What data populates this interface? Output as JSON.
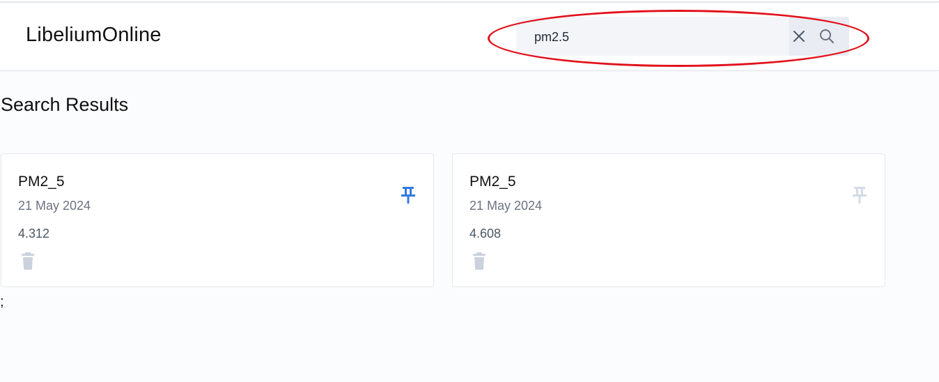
{
  "app": {
    "title": "LibeliumOnline"
  },
  "search": {
    "value": "pm2.5",
    "clear_icon": "close-icon",
    "submit_icon": "search-icon"
  },
  "results": {
    "heading": "Search Results",
    "cards": [
      {
        "title": "PM2_5",
        "date": "21 May 2024",
        "value": "4.312",
        "pinned": true
      },
      {
        "title": "PM2_5",
        "date": "21 May 2024",
        "value": "4.608",
        "pinned": false
      }
    ],
    "trailing_text": ";"
  },
  "colors": {
    "pin_active": "#2f7be0",
    "pin_inactive": "#d4dbe6",
    "delete_icon": "#cbd2dd",
    "highlight": "#e2111b",
    "background": "#fbfcfe"
  }
}
